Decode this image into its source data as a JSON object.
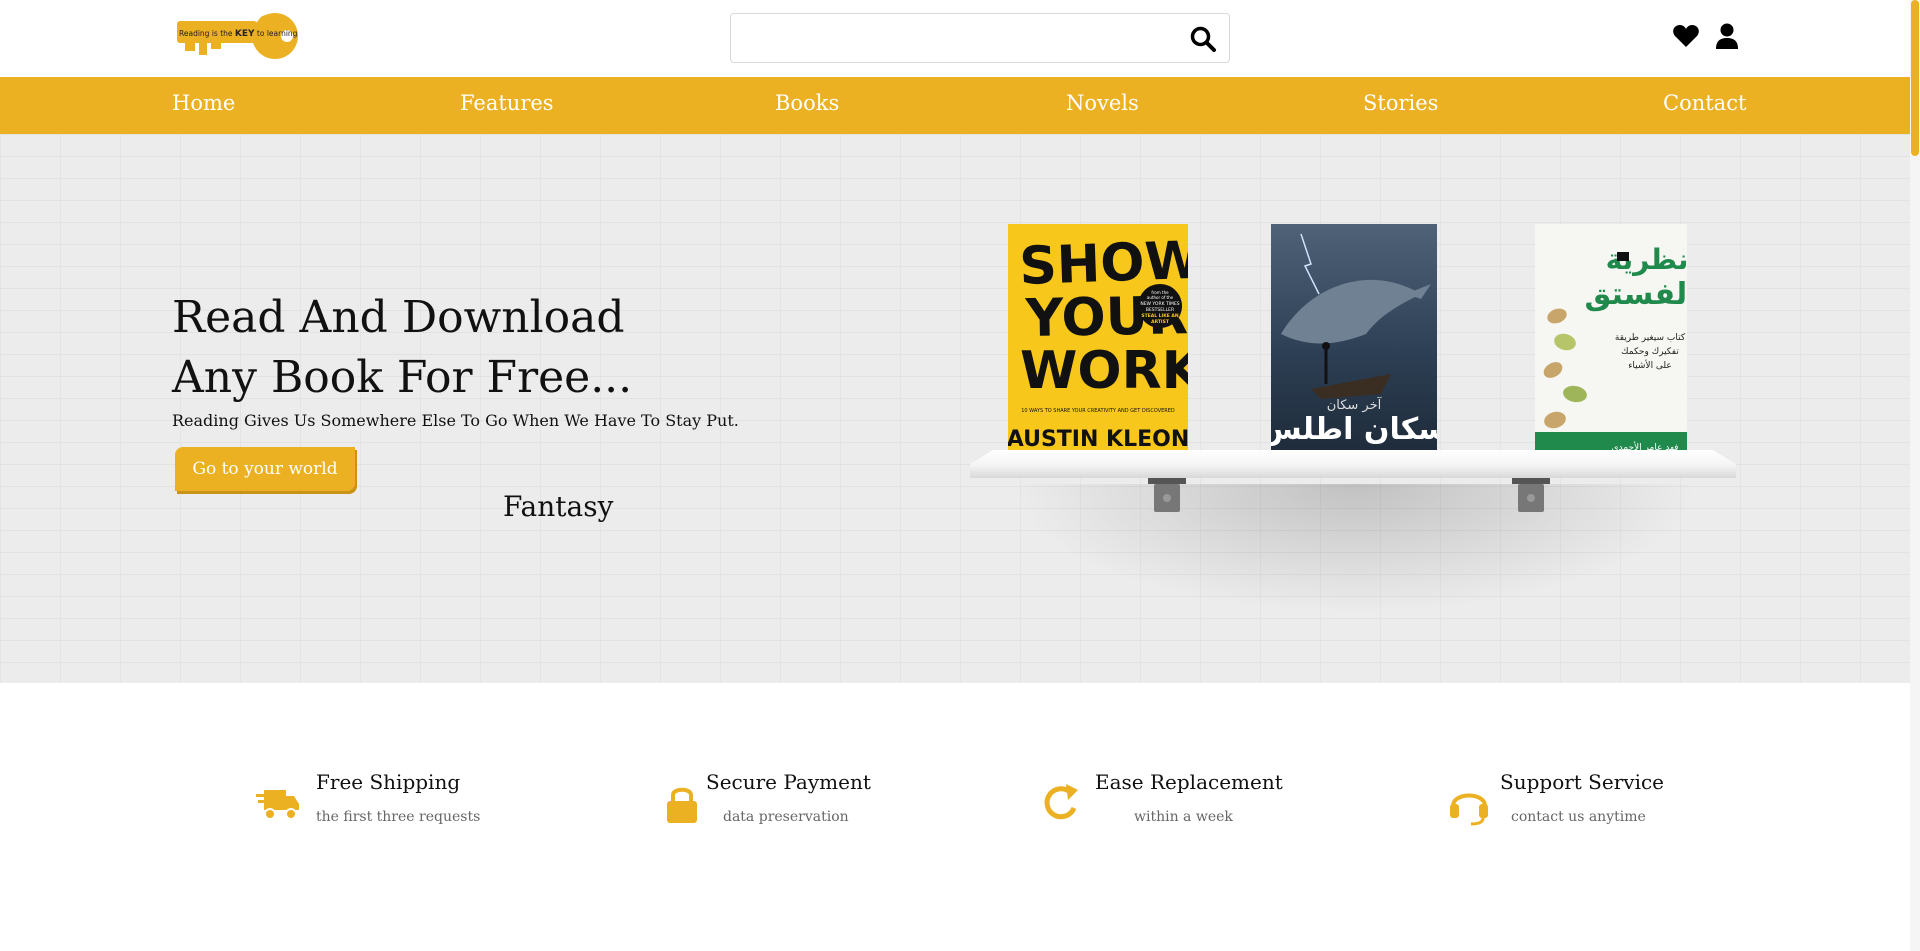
{
  "header": {
    "logo_text": {
      "prefix": "Reading is the ",
      "key": "KEY",
      "suffix": " to learning"
    },
    "search_placeholder": "",
    "icons": [
      "search-icon",
      "heart-icon",
      "user-icon"
    ]
  },
  "nav": {
    "items": [
      "Home",
      "Features",
      "Books",
      "Novels",
      "Stories",
      "Contact"
    ]
  },
  "hero": {
    "title_line1": "Read And Download",
    "title_line2": "Any Book For Free...",
    "subtitle": "Reading Gives Us Somewhere Else To Go When We Have To Stay Put.",
    "button_label": "Go to your world",
    "rotating_word": "Fantasy"
  },
  "books": [
    {
      "title_lines": [
        "SHOW",
        "YOUR",
        "WORK!"
      ],
      "tagline": "10 WAYS TO SHARE YOUR CREATIVITY AND GET DISCOVERED",
      "author": "AUSTIN KLEON",
      "badge": [
        "from the",
        "author of the",
        "NEW YORK TIMES",
        "BESTSELLER",
        "STEAL LIKE AN",
        "ARTIST"
      ],
      "colors": {
        "bg": "#f7c81b",
        "text": "#111111"
      }
    },
    {
      "title": "سكان اطلس",
      "subtitle": "آخر سكان",
      "colors": {
        "bg": "#2d3f54",
        "text": "#ffffff"
      }
    },
    {
      "title_lines": [
        "نظرية",
        "الفستق"
      ],
      "description": [
        "كتاب سيغير طريقة",
        "تفكيرك وحكمك",
        "على الأشياء"
      ],
      "author": "فهد عامر الأحمدي",
      "colors": {
        "bg": "#f6f6f2",
        "accent": "#1f8a4c"
      }
    }
  ],
  "features": [
    {
      "icon": "truck-icon",
      "title": "Free Shipping",
      "desc": "the first three requests"
    },
    {
      "icon": "lock-icon",
      "title": "Secure Payment",
      "desc": "data preservation"
    },
    {
      "icon": "refresh-icon",
      "title": "Ease Replacement",
      "desc": "within a week"
    },
    {
      "icon": "headset-icon",
      "title": "Support Service",
      "desc": "contact us anytime"
    }
  ],
  "theme": {
    "accent": "#ebb122",
    "hero_bg": "#ececec",
    "text": "#111111"
  }
}
